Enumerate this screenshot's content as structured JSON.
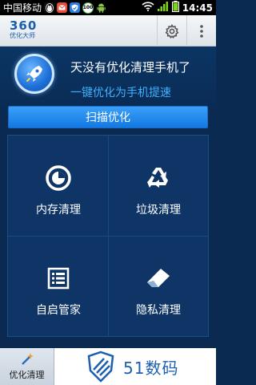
{
  "status_bar": {
    "carrier": "中国移动",
    "time": "14:45",
    "icons": [
      "penguin-icon",
      "mail-icon",
      "shield-check-icon",
      "battery-100-icon",
      "android-icon",
      "wifi-icon",
      "signal-icon",
      "battery-icon"
    ],
    "badge_100": "100"
  },
  "header": {
    "logo_main": "360",
    "logo_sub": "优化大师"
  },
  "promo": {
    "title": "天没有优化清理手机了",
    "subtitle": "一键优化为手机提速"
  },
  "scan_button": "扫描优化",
  "grid": {
    "items": [
      {
        "label": "内存清理",
        "icon": "memory-icon"
      },
      {
        "label": "垃圾清理",
        "icon": "recycle-icon"
      },
      {
        "label": "自启管家",
        "icon": "startup-list-icon"
      },
      {
        "label": "隐私清理",
        "icon": "eraser-icon"
      }
    ]
  },
  "bottom_bar": {
    "tab_label": "优化清理",
    "watermark": "51数码"
  },
  "colors": {
    "background": "#0a2a52",
    "accent": "#1379e3",
    "subtitle": "#3fb0ff"
  }
}
